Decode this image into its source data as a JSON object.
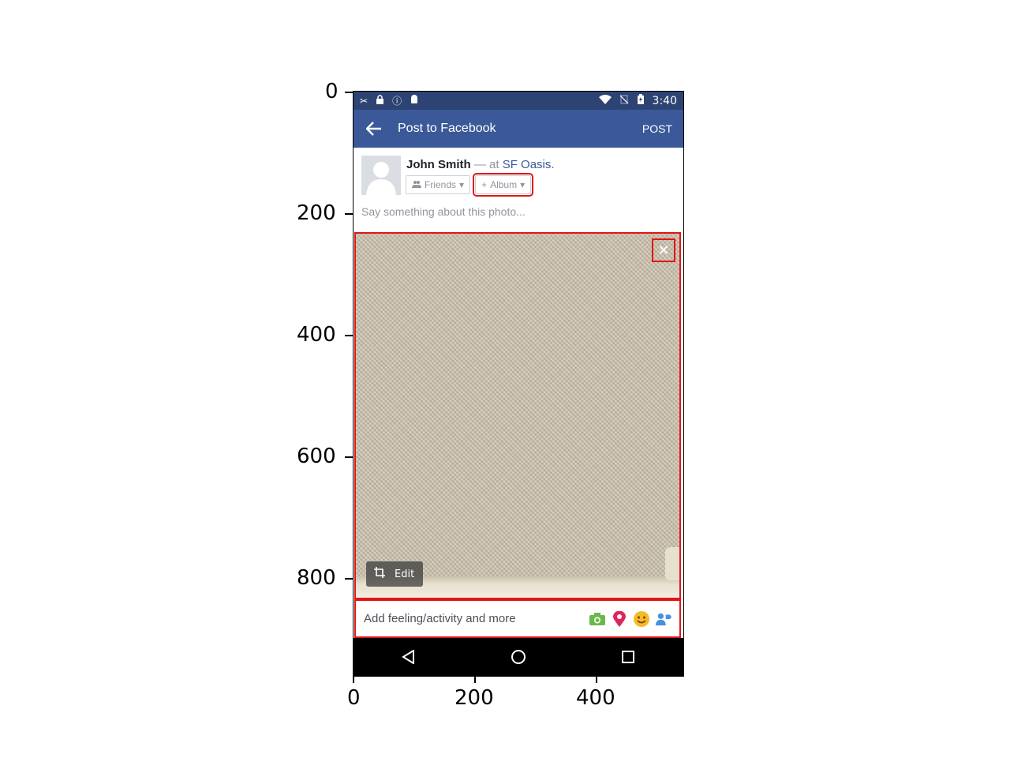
{
  "status_bar": {
    "left_icons": [
      "tools-icon",
      "lock-icon",
      "info-icon",
      "android-icon"
    ],
    "right_icons": [
      "wifi-icon",
      "no-sim-icon",
      "battery-icon"
    ],
    "time": "3:40"
  },
  "app_bar": {
    "title": "Post to Facebook",
    "post_label": "POST"
  },
  "composer": {
    "name": "John Smith",
    "dash": "—",
    "at": "at",
    "place": "SF Oasis.",
    "friends_label": "Friends",
    "album_label": "Album",
    "placeholder": "Say something about this photo..."
  },
  "photo": {
    "edit_label": "Edit"
  },
  "feeling_bar": {
    "label": "Add feeling/activity and more",
    "icons": [
      "camera-icon",
      "location-pin-icon",
      "emoji-icon",
      "tag-people-icon"
    ],
    "colors": {
      "camera": "#6bb84a",
      "pin": "#e0245e",
      "emoji": "#f7b928",
      "tag": "#4a90e2"
    }
  },
  "axes": {
    "y_ticks": [
      "0",
      "200",
      "400",
      "600",
      "800"
    ],
    "x_ticks": [
      "0",
      "200",
      "400"
    ]
  },
  "colors": {
    "fb_blue": "#3b5998",
    "status_blue": "#2d4373",
    "highlight_red": "#e01616"
  }
}
